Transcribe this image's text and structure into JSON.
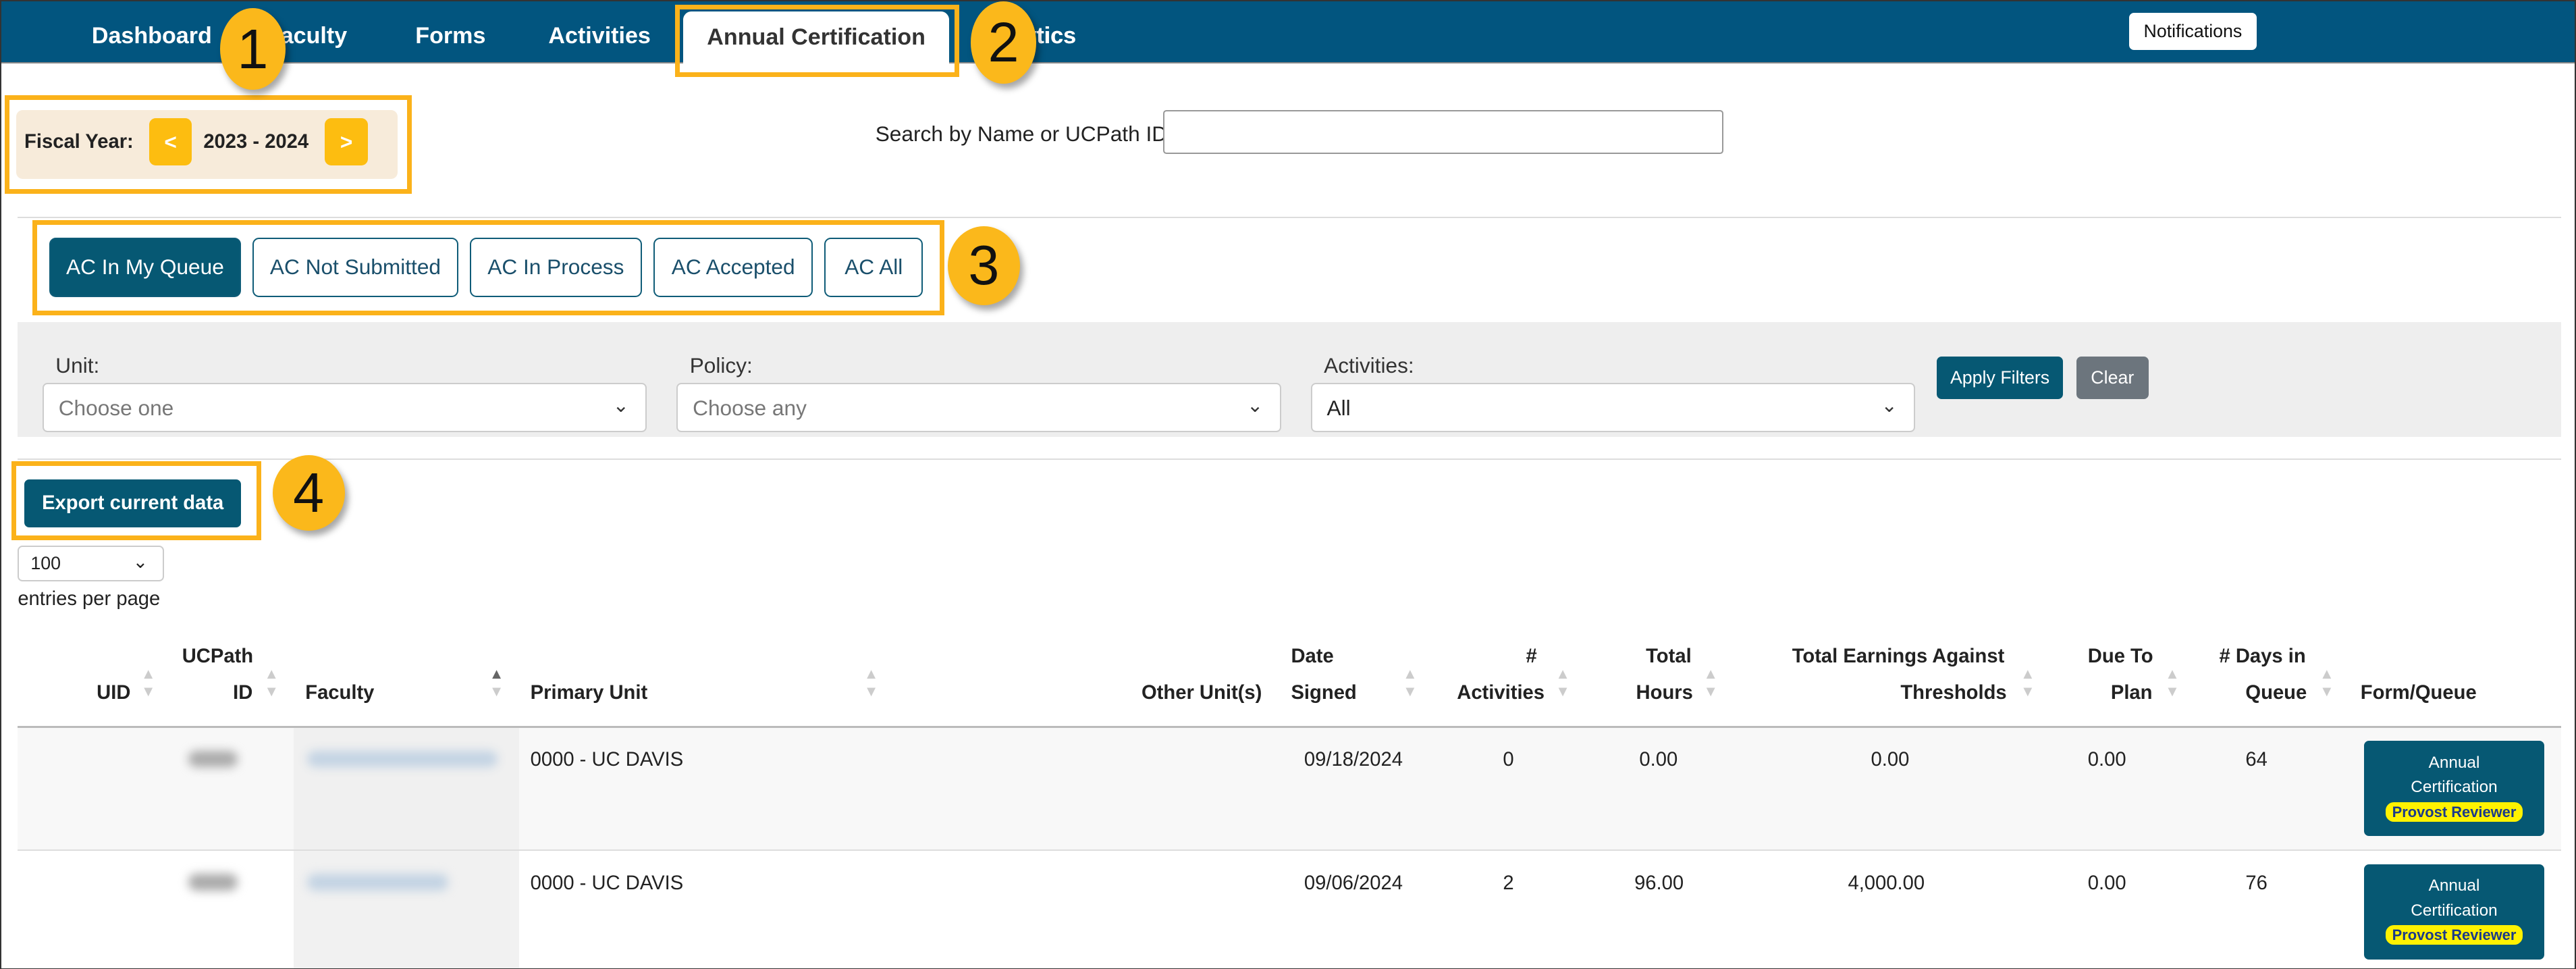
{
  "nav": {
    "items": [
      "Dashboard",
      "Faculty",
      "Forms",
      "Activities",
      "Annual Certification",
      "Analytics"
    ],
    "visible_fragments": {
      "faculty": "aculty",
      "analytics": "tics"
    },
    "active": "Annual Certification",
    "notifications": "Notifications"
  },
  "callouts": [
    "1",
    "2",
    "3",
    "4"
  ],
  "fiscal_year": {
    "label": "Fiscal Year:",
    "prev": "<",
    "value": "2023 - 2024",
    "next": ">"
  },
  "search": {
    "label": "Search by Name or UCPath ID:",
    "value": ""
  },
  "tabs": [
    "AC In My Queue",
    "AC Not Submitted",
    "AC In Process",
    "AC Accepted",
    "AC All"
  ],
  "active_tab": "AC In My Queue",
  "filters": {
    "unit": {
      "label": "Unit:",
      "value": "Choose one"
    },
    "policy": {
      "label": "Policy:",
      "value": "Choose any"
    },
    "activities": {
      "label": "Activities:",
      "value": "All"
    },
    "apply": "Apply Filters",
    "clear": "Clear"
  },
  "export": "Export current data",
  "page_size": {
    "value": "100",
    "label": "entries per page"
  },
  "table": {
    "headers": {
      "uid": "UID",
      "ucpath1": "UCPath",
      "ucpath2": "ID",
      "faculty": "Faculty",
      "unit": "Primary Unit",
      "other": "Other Unit(s)",
      "date1": "Date",
      "date2": "Signed",
      "act1": "#",
      "act2": "Activities",
      "hrs1": "Total",
      "hrs2": "Hours",
      "earn1": "Total Earnings Against",
      "earn2": "Thresholds",
      "due1": "Due To",
      "due2": "Plan",
      "days1": "# Days in",
      "days2": "Queue",
      "form": "Form/Queue"
    },
    "rows": [
      {
        "unit": "0000 - UC DAVIS",
        "other": "",
        "date": "09/18/2024",
        "activities": "0",
        "hours": "0.00",
        "earnings": "0.00",
        "due": "0.00",
        "days": "64",
        "form": "Annual Certification",
        "queue": "Provost Reviewer"
      },
      {
        "unit": "0000 - UC DAVIS",
        "other": "",
        "date": "09/06/2024",
        "activities": "2",
        "hours": "96.00",
        "earnings": "4,000.00",
        "due": "0.00",
        "days": "76",
        "form": "Annual Certification",
        "queue": "Provost Reviewer"
      }
    ]
  },
  "colors": {
    "nav": "#02557f",
    "primary": "#065873",
    "callout": "#fbb21a",
    "badge": "#fff200"
  }
}
